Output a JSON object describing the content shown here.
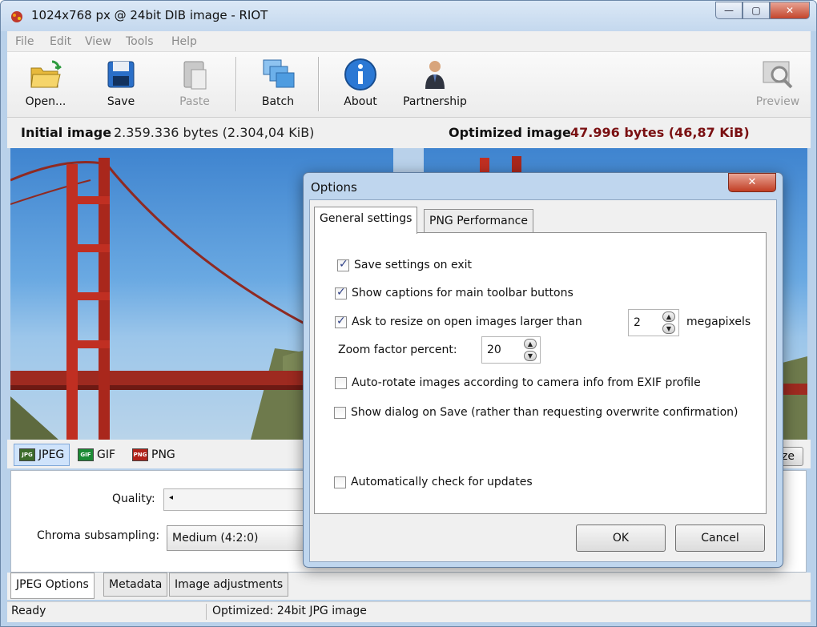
{
  "window": {
    "title": "1024x768 px @ 24bit  DIB image - RIOT",
    "minimize_glyph": "—",
    "maximize_glyph": "▢",
    "close_glyph": "✕"
  },
  "menu": [
    "File",
    "Edit",
    "View",
    "Tools",
    "Help"
  ],
  "toolbar": {
    "open": "Open...",
    "save": "Save",
    "paste": "Paste",
    "batch": "Batch",
    "about": "About",
    "partnership": "Partnership",
    "preview": "Preview"
  },
  "info": {
    "initial_label": "Initial image",
    "initial_value": "2.359.336 bytes (2.304,04 KiB)",
    "optimized_label": "Optimized image",
    "optimized_value": "47.996 bytes (46,87 KiB)"
  },
  "formats": {
    "jpeg": "JPEG",
    "gif": "GIF",
    "png": "PNG",
    "jpeg_icon": "JPG",
    "gif_icon": "GIF",
    "png_icon": "PNG"
  },
  "jpeg_options": {
    "quality_label": "Quality:",
    "chroma_label": "Chroma subsampling:",
    "chroma_value": "Medium (4:2:0)",
    "resize_fragment": "ze"
  },
  "bottom_tabs": [
    "JPEG Options",
    "Metadata",
    "Image adjustments"
  ],
  "status": {
    "left": "Ready",
    "right": "Optimized: 24bit JPG image"
  },
  "dialog": {
    "title": "Options",
    "close_glyph": "✕",
    "tabs": [
      "General settings",
      "PNG Performance"
    ],
    "options": [
      {
        "label": "Save settings on exit",
        "checked": true
      },
      {
        "label": "Show captions for main toolbar buttons",
        "checked": true
      },
      {
        "label": "Ask to resize on open images larger than",
        "checked": true
      },
      {
        "label": "Auto-rotate images according to camera info from EXIF profile",
        "checked": false
      },
      {
        "label": "Show dialog on Save (rather than requesting overwrite confirmation)",
        "checked": false
      },
      {
        "label": "Automatically check for updates",
        "checked": false
      }
    ],
    "megapixels_value": "2",
    "megapixels_unit": "megapixels",
    "zoom_label": "Zoom factor percent:",
    "zoom_value": "20",
    "ok": "OK",
    "cancel": "Cancel"
  },
  "colors": {
    "optimized_size": "#7a1012",
    "bridge": "#b3261e",
    "sky": "#4f91d6"
  }
}
